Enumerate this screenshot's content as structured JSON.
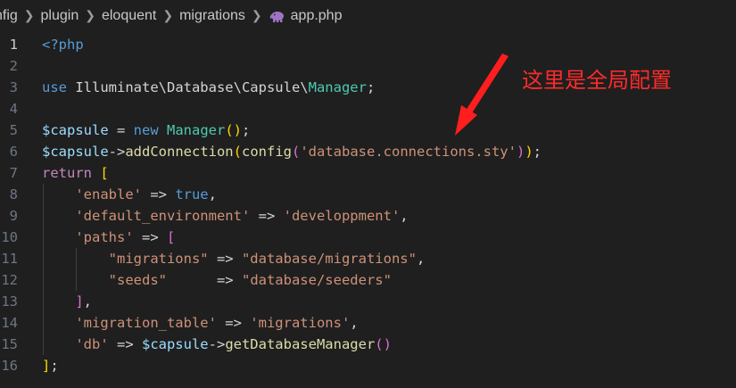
{
  "breadcrumb": [
    {
      "label": "nfig"
    },
    {
      "label": "plugin"
    },
    {
      "label": "eloquent"
    },
    {
      "label": "migrations"
    },
    {
      "label": "app.php",
      "icon": "php-elephant-icon"
    }
  ],
  "colors": {
    "background": "#1f1f1f",
    "annotation": "#ff2a2a",
    "keyword": "#569cd6",
    "variable": "#9cdcfe",
    "function": "#dcdcaa",
    "class": "#4ec9b0",
    "string": "#ce9178"
  },
  "annotation": {
    "text": "这里是全局配置"
  },
  "editor": {
    "active_line": 1,
    "lines": [
      {
        "n": "1",
        "tokens": [
          {
            "t": "<?php",
            "c": "keyword"
          }
        ]
      },
      {
        "n": "2",
        "tokens": []
      },
      {
        "n": "3",
        "tokens": [
          {
            "t": "use",
            "c": "keyword"
          },
          {
            "t": " Illuminate\\Database\\Capsule\\",
            "c": "plain"
          },
          {
            "t": "Manager",
            "c": "class"
          },
          {
            "t": ";",
            "c": "plain"
          }
        ]
      },
      {
        "n": "4",
        "tokens": []
      },
      {
        "n": "5",
        "tokens": [
          {
            "t": "$capsule",
            "c": "var"
          },
          {
            "t": " = ",
            "c": "op"
          },
          {
            "t": "new",
            "c": "keyword"
          },
          {
            "t": " ",
            "c": "plain"
          },
          {
            "t": "Manager",
            "c": "class"
          },
          {
            "t": "(",
            "c": "bracket1"
          },
          {
            "t": ")",
            "c": "bracket1"
          },
          {
            "t": ";",
            "c": "plain"
          }
        ]
      },
      {
        "n": "6",
        "tokens": [
          {
            "t": "$capsule",
            "c": "var"
          },
          {
            "t": "->",
            "c": "op"
          },
          {
            "t": "addConnection",
            "c": "func"
          },
          {
            "t": "(",
            "c": "bracket1"
          },
          {
            "t": "config",
            "c": "func"
          },
          {
            "t": "(",
            "c": "bracket2"
          },
          {
            "t": "'database.connections.sty'",
            "c": "string"
          },
          {
            "t": ")",
            "c": "bracket2"
          },
          {
            "t": ")",
            "c": "bracket1"
          },
          {
            "t": ";",
            "c": "plain"
          }
        ]
      },
      {
        "n": "7",
        "tokens": [
          {
            "t": "return",
            "c": "control"
          },
          {
            "t": " ",
            "c": "plain"
          },
          {
            "t": "[",
            "c": "bracket1"
          }
        ]
      },
      {
        "n": "8",
        "tokens": [
          {
            "t": "    ",
            "c": "plain"
          },
          {
            "t": "'enable'",
            "c": "string"
          },
          {
            "t": " => ",
            "c": "op"
          },
          {
            "t": "true",
            "c": "keyword"
          },
          {
            "t": ",",
            "c": "plain"
          }
        ]
      },
      {
        "n": "9",
        "tokens": [
          {
            "t": "    ",
            "c": "plain"
          },
          {
            "t": "'default_environment'",
            "c": "string"
          },
          {
            "t": " => ",
            "c": "op"
          },
          {
            "t": "'developpment'",
            "c": "string"
          },
          {
            "t": ",",
            "c": "plain"
          }
        ]
      },
      {
        "n": "10",
        "tokens": [
          {
            "t": "    ",
            "c": "plain"
          },
          {
            "t": "'paths'",
            "c": "string"
          },
          {
            "t": " => ",
            "c": "op"
          },
          {
            "t": "[",
            "c": "bracket2"
          }
        ]
      },
      {
        "n": "11",
        "tokens": [
          {
            "t": "        ",
            "c": "plain"
          },
          {
            "t": "\"migrations\"",
            "c": "string"
          },
          {
            "t": " => ",
            "c": "op"
          },
          {
            "t": "\"database/migrations\"",
            "c": "string"
          },
          {
            "t": ",",
            "c": "plain"
          }
        ]
      },
      {
        "n": "12",
        "tokens": [
          {
            "t": "        ",
            "c": "plain"
          },
          {
            "t": "\"seeds\"",
            "c": "string"
          },
          {
            "t": "      => ",
            "c": "op"
          },
          {
            "t": "\"database/seeders\"",
            "c": "string"
          }
        ]
      },
      {
        "n": "13",
        "tokens": [
          {
            "t": "    ",
            "c": "plain"
          },
          {
            "t": "]",
            "c": "bracket2"
          },
          {
            "t": ",",
            "c": "plain"
          }
        ]
      },
      {
        "n": "14",
        "tokens": [
          {
            "t": "    ",
            "c": "plain"
          },
          {
            "t": "'migration_table'",
            "c": "string"
          },
          {
            "t": " => ",
            "c": "op"
          },
          {
            "t": "'migrations'",
            "c": "string"
          },
          {
            "t": ",",
            "c": "plain"
          }
        ]
      },
      {
        "n": "15",
        "tokens": [
          {
            "t": "    ",
            "c": "plain"
          },
          {
            "t": "'db'",
            "c": "string"
          },
          {
            "t": " => ",
            "c": "op"
          },
          {
            "t": "$capsule",
            "c": "var"
          },
          {
            "t": "->",
            "c": "op"
          },
          {
            "t": "getDatabaseManager",
            "c": "func"
          },
          {
            "t": "(",
            "c": "bracket2"
          },
          {
            "t": ")",
            "c": "bracket2"
          }
        ]
      },
      {
        "n": "16",
        "tokens": [
          {
            "t": "]",
            "c": "bracket1"
          },
          {
            "t": ";",
            "c": "plain"
          }
        ]
      }
    ]
  }
}
